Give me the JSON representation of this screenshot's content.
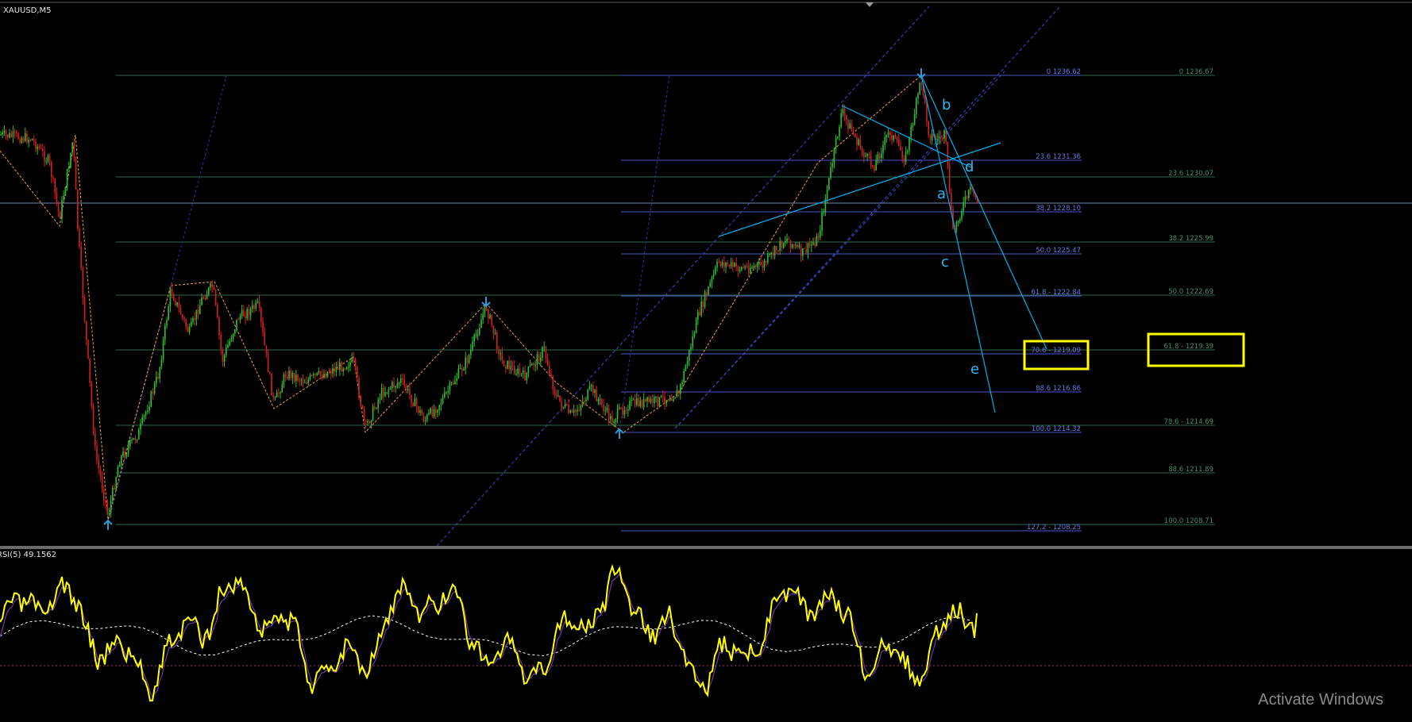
{
  "window": {
    "title": "XAUUSD,M5",
    "watermark": "Activate Windows"
  },
  "colors": {
    "background": "#000000",
    "bull_candle": "#2fbf2f",
    "bear_candle": "#d42020",
    "fibo_level": "#5a6acd",
    "fibo_level_alt": "#2e7a50",
    "channel": "#3c4ad0",
    "zigzag": "#f0a030",
    "elliott": "#00b0f0",
    "rsi_line": "#ffff00",
    "rsi_signal": "#6a3aa0",
    "highlight_box": "#ffff00"
  },
  "fib_right": [
    {
      "label": "0 1236.67"
    },
    {
      "label": "23.6 1230.07"
    },
    {
      "label": "38.2 1225.99"
    },
    {
      "label": "50.0 1222.69"
    },
    {
      "label": "61.8 - 1219.39"
    },
    {
      "label": "78.6 - 1214.69"
    },
    {
      "label": "88.6 1211.89"
    },
    {
      "label": "100.0 1208.71"
    }
  ],
  "fib_mid": [
    {
      "label": "0 1236.62"
    },
    {
      "label": "23.6 1231.36"
    },
    {
      "label": "38.2 1228.10"
    },
    {
      "label": "50.0 1225.47"
    },
    {
      "label": "61.8 - 1222.84"
    },
    {
      "label": "70.6 - 1219.09"
    },
    {
      "label": "88.6 1216.86"
    },
    {
      "label": "100.0 1214.32"
    },
    {
      "label": "127.2 - 1208.25"
    }
  ],
  "wave_labels": [
    "a",
    "b",
    "c",
    "d",
    "e"
  ],
  "rsi": {
    "label": "RSI(5) 49.1562"
  }
}
